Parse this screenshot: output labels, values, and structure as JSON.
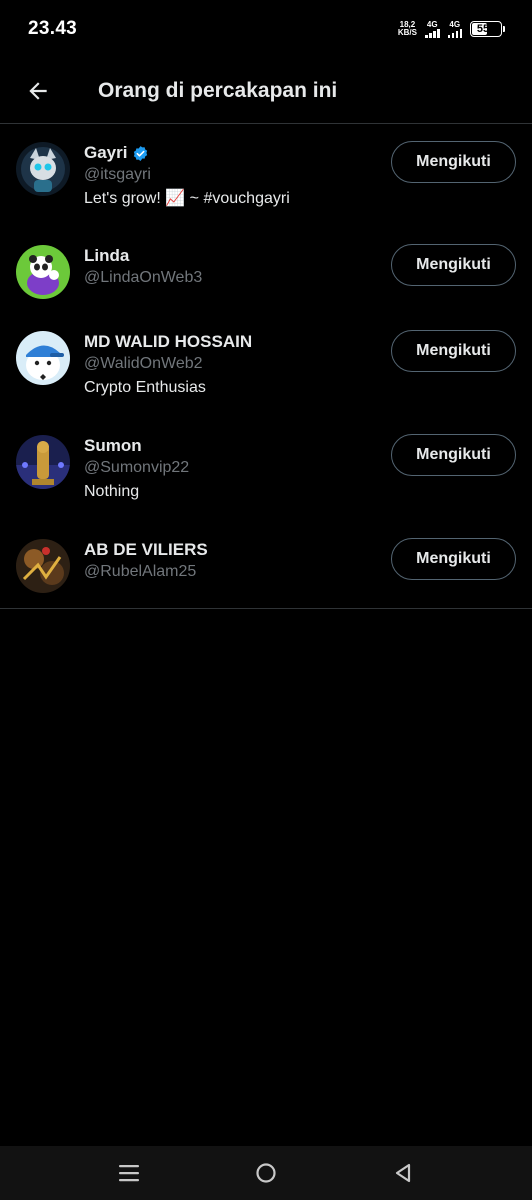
{
  "status_bar": {
    "time": "23.43",
    "net_speed_value": "18,2",
    "net_speed_unit": "KB/S",
    "signal_1_label": "4G",
    "signal_2_label": "4G",
    "battery_level": "55"
  },
  "header": {
    "title": "Orang di percakapan ini",
    "back_icon": "arrow-left-icon"
  },
  "users": [
    {
      "name": "Gayri",
      "verified": true,
      "handle": "@itsgayri",
      "bio": "Let's grow! 📈 ~ #vouchgayri",
      "follow_label": "Mengikuti",
      "avatar_color": "#1b2a3a"
    },
    {
      "name": "Linda",
      "verified": false,
      "handle": "@LindaOnWeb3",
      "bio": "",
      "follow_label": "Mengikuti",
      "avatar_color": "#6cc93a"
    },
    {
      "name": "MD WALID HOSSAIN",
      "verified": false,
      "handle": "@WalidOnWeb2",
      "bio": "Crypto Enthusias",
      "follow_label": "Mengikuti",
      "avatar_color": "#cfe6f5"
    },
    {
      "name": "Sumon",
      "verified": false,
      "handle": "@Sumonvip22",
      "bio": "Nothing",
      "follow_label": "Mengikuti",
      "avatar_color": "#1b1f4a"
    },
    {
      "name": "AB DE VILIERS",
      "verified": false,
      "handle": "@RubelAlam25",
      "bio": "",
      "follow_label": "Mengikuti",
      "avatar_color": "#3a2a1a"
    }
  ],
  "nav_bar": {
    "recents_icon": "menu-lines-icon",
    "home_icon": "circle-home-icon",
    "back_icon": "triangle-back-icon"
  },
  "colors": {
    "background": "#000000",
    "divider": "#2f3336",
    "secondary_text": "#71767b",
    "verified_blue": "#1d9bf0"
  }
}
